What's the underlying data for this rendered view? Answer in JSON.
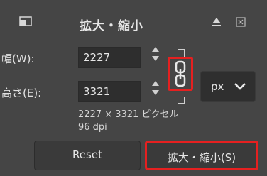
{
  "dialog": {
    "title": "拡大・縮小",
    "icons": {
      "scale": "scale-icon",
      "collapse": "collapse-arrow-icon",
      "close": "close-icon"
    }
  },
  "width": {
    "label": "幅(W):",
    "value": "2227"
  },
  "height": {
    "label": "高さ(E):",
    "value": "3321"
  },
  "chain": {
    "icon": "chain-link-icon",
    "highlight_color": "#e52020"
  },
  "unit": {
    "value": "px"
  },
  "info": {
    "dimensions": "2227 × 3321 ピクセル",
    "resolution": "96 dpi"
  },
  "buttons": {
    "reset": "Reset",
    "scale": "拡大・縮小(S)"
  },
  "colors": {
    "background": "#454545",
    "input_bg": "#2e2e2e",
    "text": "#dcdcdc",
    "highlight": "#e52020"
  }
}
